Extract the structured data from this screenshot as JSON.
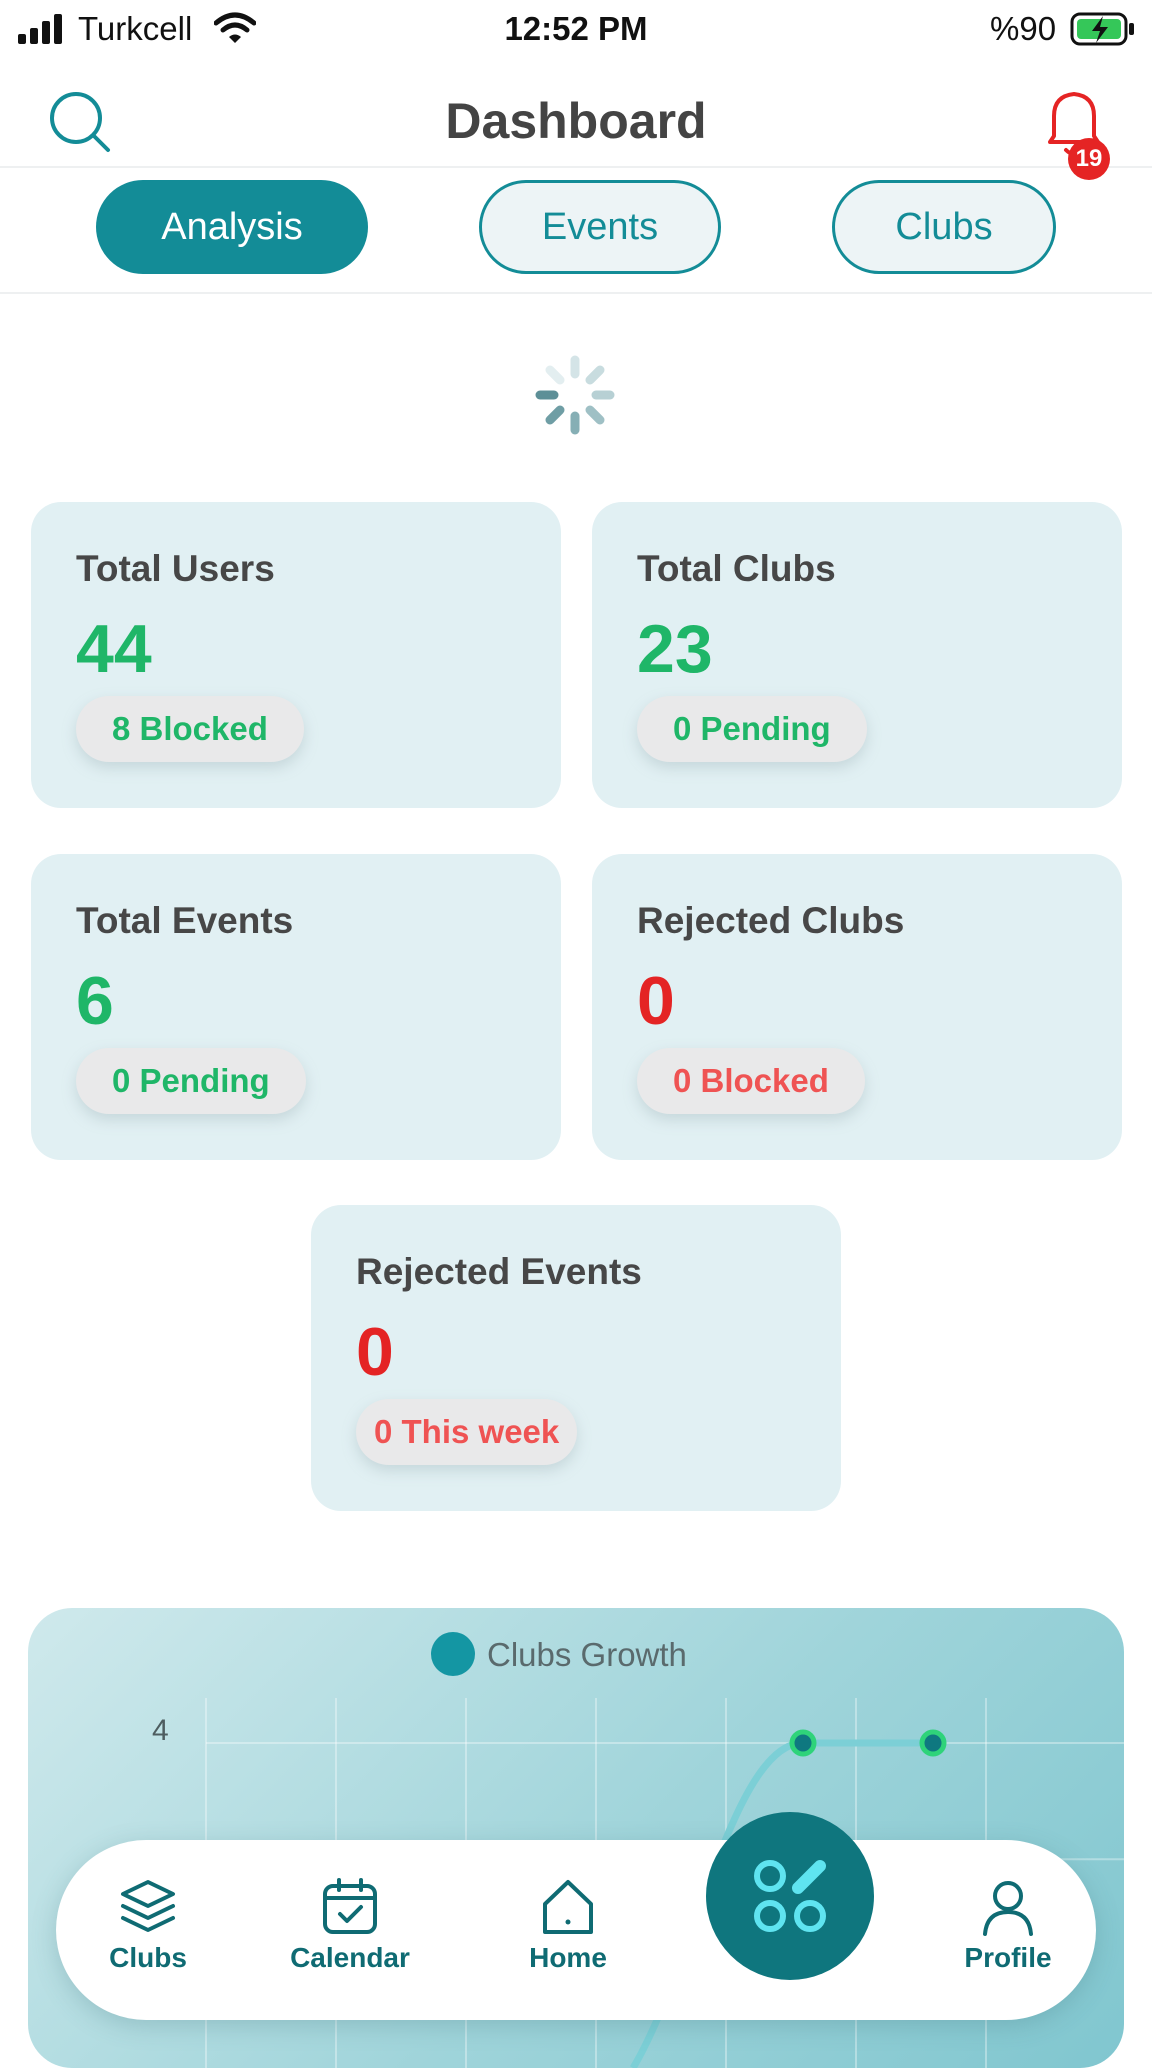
{
  "status_bar": {
    "carrier": "Turkcell",
    "time": "12:52 PM",
    "battery": "%90"
  },
  "header": {
    "title": "Dashboard",
    "notification_count": "19"
  },
  "tabs": [
    {
      "label": "Analysis",
      "active": true
    },
    {
      "label": "Events",
      "active": false
    },
    {
      "label": "Clubs",
      "active": false
    }
  ],
  "stats": {
    "total_users": {
      "label": "Total Users",
      "value": "44",
      "pill": "8 Blocked"
    },
    "total_clubs": {
      "label": "Total Clubs",
      "value": "23",
      "pill": "0 Pending"
    },
    "total_events": {
      "label": "Total Events",
      "value": "6",
      "pill": "0 Pending"
    },
    "rejected_clubs": {
      "label": "Rejected Clubs",
      "value": "0",
      "pill": "0 Blocked"
    },
    "rejected_events": {
      "label": "Rejected Events",
      "value": "0",
      "pill": "0 This week"
    }
  },
  "chart_data": {
    "type": "line",
    "series": [
      {
        "name": "Clubs Growth",
        "values": [
          null,
          null,
          null,
          null,
          4,
          4
        ]
      }
    ],
    "ylim": [
      0,
      4
    ],
    "y_ticks_visible": [
      "4"
    ],
    "grid": true,
    "legend": "top-center",
    "color": "#1496a3"
  },
  "bottom_nav": {
    "items": [
      {
        "label": "Clubs",
        "icon": "layers-icon"
      },
      {
        "label": "Calendar",
        "icon": "calendar-check-icon"
      },
      {
        "label": "Home",
        "icon": "home-icon"
      },
      {
        "label": "Profile",
        "icon": "user-icon"
      }
    ],
    "center_icon": "apps-icon"
  },
  "colors": {
    "accent": "#138c97",
    "positive": "#1fb668",
    "negative": "#e42424"
  }
}
